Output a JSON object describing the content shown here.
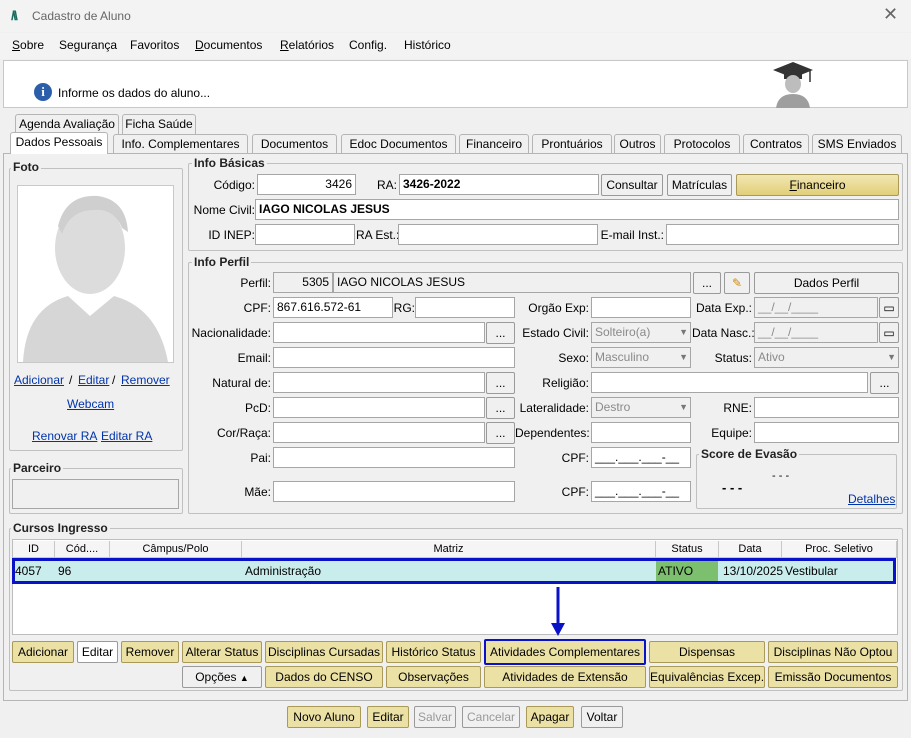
{
  "window": {
    "title": "Cadastro de Aluno",
    "logo": "M"
  },
  "menu": [
    "Sobre",
    "Segurança",
    "Favoritos",
    "Documentos",
    "Relatórios",
    "Config.",
    "Histórico"
  ],
  "banner": {
    "text": "Informe os dados do aluno..."
  },
  "tabs_row1": [
    "Agenda Avaliação",
    "Ficha Saúde"
  ],
  "tabs_row2": [
    "Dados Pessoais",
    "Info. Complementares",
    "Documentos",
    "Edoc Documentos",
    "Financeiro",
    "Prontuários",
    "Outros",
    "Protocolos",
    "Contratos",
    "SMS Enviados"
  ],
  "foto": {
    "title": "Foto",
    "adicionar": "Adicionar",
    "sep": "/",
    "editar": "Editar",
    "remover": "Remover",
    "webcam": "Webcam",
    "renovar_ra": "Renovar RA",
    "editar_ra": "Editar RA"
  },
  "parceiro": {
    "title": "Parceiro"
  },
  "info_basicas": {
    "title": "Info Básicas",
    "codigo_label": "Código:",
    "codigo": "3426",
    "ra_label": "RA:",
    "ra": "3426-2022",
    "consultar": "Consultar",
    "matriculas": "Matrículas",
    "financeiro": "Financeiro",
    "nome_label": "Nome Civil:",
    "nome": "IAGO NICOLAS JESUS",
    "inep_label": "ID INEP:",
    "ra_est_label": "RA Est.:",
    "email_inst_label": "E-mail Inst.:"
  },
  "info_perfil": {
    "title": "Info Perfil",
    "perfil_label": "Perfil:",
    "perfil_code": "5305",
    "perfil_name": "IAGO NICOLAS JESUS",
    "ellipsis": "...",
    "dados_perfil": "Dados Perfil",
    "cpf_label": "CPF:",
    "cpf": "867.616.572-61",
    "rg_label": "RG:",
    "orgao_label": "Orgão Exp:",
    "data_exp_label": "Data Exp.:",
    "date_mask": "__/__/____",
    "nac_label": "Nacionalidade:",
    "estado_civil_label": "Estado Civil:",
    "estado_civil": "Solteiro(a)",
    "data_nasc_label": "Data Nasc.:",
    "email_label": "Email:",
    "sexo_label": "Sexo:",
    "sexo": "Masculino",
    "status_label": "Status:",
    "status": "Ativo",
    "natural_label": "Natural de:",
    "religiao_label": "Religião:",
    "pcd_label": "PcD:",
    "lateralidade_label": "Lateralidade:",
    "lateralidade": "Destro",
    "rne_label": "RNE:",
    "cor_label": "Cor/Raça:",
    "dependentes_label": "Dependentes:",
    "equipe_label": "Equipe:",
    "pai_label": "Pai:",
    "mae_label": "Mãe:",
    "cpf2_label": "CPF:",
    "cpf_mask": "___.___.___-__",
    "score_title": "Score de Evasão",
    "score_dash1": "- - -",
    "score_dash2": "- - -",
    "detalhes": "Detalhes"
  },
  "cursos": {
    "title": "Cursos Ingresso",
    "columns": [
      "ID",
      "Cód....",
      "Câmpus/Polo",
      "Matriz",
      "Status",
      "Data",
      "Proc. Seletivo"
    ],
    "row": {
      "id": "4057",
      "cod": "96",
      "campus": "",
      "matriz": "Administração",
      "status": "ATIVO",
      "data": "13/10/2025",
      "proc": "Vestibular"
    }
  },
  "actions_row1": [
    "Adicionar",
    "Editar",
    "Remover",
    "Alterar Status",
    "Disciplinas Cursadas",
    "Histórico Status",
    "Atividades Complementares",
    "Dispensas",
    "Disciplinas Não Optou"
  ],
  "actions_row2": [
    "Opções",
    "Dados do CENSO",
    "Observações",
    "Atividades de Extensão",
    "Equivalências Excep.",
    "Emissão Documentos"
  ],
  "footer": [
    "Novo Aluno",
    "Editar",
    "Salvar",
    "Cancelar",
    "Apagar",
    "Voltar"
  ],
  "colors": {
    "highlight": "#0a12c8",
    "row_bg": "#c9ecec",
    "status_bg": "#7cbf6e"
  }
}
